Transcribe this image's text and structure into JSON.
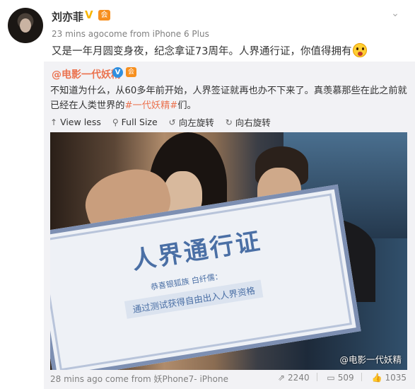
{
  "author": {
    "name": "刘亦菲",
    "verified_mark": "V",
    "member_mark": "会",
    "avatar_icon": "avatar-portrait"
  },
  "post": {
    "time": "23 mins ago",
    "source": "come from iPhone 6 Plus",
    "text": "又是一年月圆变身夜，纪念拿证73周年。人界通行证，你值得拥有",
    "emoji_icon": "surprised-face-emoji"
  },
  "more_icon": "chevron-down",
  "repost": {
    "author": "@电影一代妖精",
    "verified_mark": "V",
    "member_mark": "会",
    "text_before": "不知道为什么，从60多年前开始，人界签证就再也办不下来了。真羡慕那些在此之前就已经在人类世界的",
    "hashtag": "#一代妖精#",
    "text_after": "们。",
    "actions": [
      {
        "icon": "arrow-up-icon",
        "label": "View less"
      },
      {
        "icon": "search-icon",
        "label": "Full Size"
      },
      {
        "icon": "rotate-left-icon",
        "label": "向左旋转"
      },
      {
        "icon": "rotate-right-icon",
        "label": "向右旋转"
      }
    ],
    "image": {
      "certificate_title": "人界通行证",
      "certificate_subtitle": "恭喜银狐族 白纤儒：",
      "certificate_line": "通过测试获得自由出入人界资格",
      "watermark": "@电影一代妖精"
    },
    "footer": {
      "time": "28 mins ago",
      "source": "come from 妖Phone7- iPhone"
    },
    "stats": {
      "reposts": "2240",
      "comments": "509",
      "likes": "1035"
    }
  },
  "colors": {
    "accent": "#eb7350",
    "text": "#333333",
    "muted": "#808080",
    "repost_bg": "#f2f2f5",
    "verified_gold": "#f7b500",
    "verified_blue": "#2f8fe0"
  }
}
